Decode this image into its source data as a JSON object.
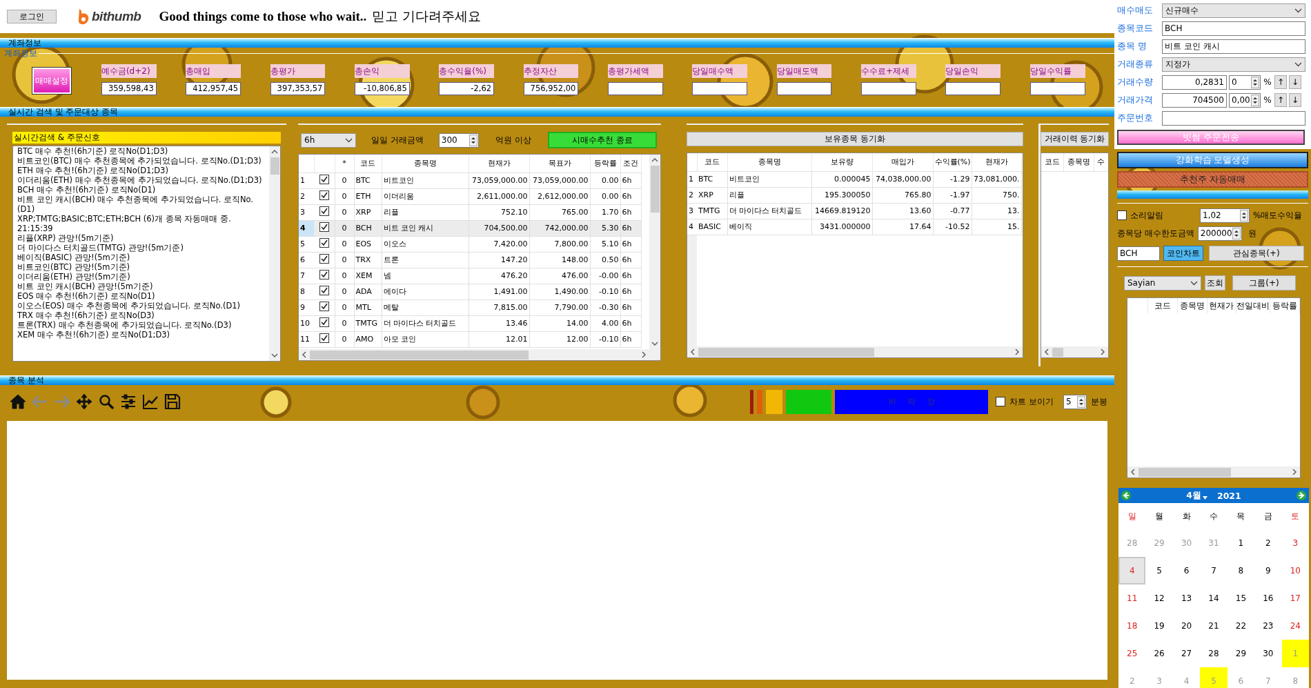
{
  "header": {
    "login_button": "로그인",
    "logo_text": "bithumb",
    "slogan": "Good things come to those who wait..",
    "slogan_korean": "믿고 기다려주세요"
  },
  "account": {
    "bar_title": "계좌정보",
    "group_title": "계좌정보",
    "settings_button": "매매설정",
    "fields": [
      {
        "label": "예수금(d+2)",
        "value": "359,598,43"
      },
      {
        "label": "총매입",
        "value": "412,957,45"
      },
      {
        "label": "총평가",
        "value": "397,353,57"
      },
      {
        "label": "총손익",
        "value": "-10,806,85"
      },
      {
        "label": "총수익율(%)",
        "value": "-2,62"
      },
      {
        "label": "추정자산",
        "value": "756,952,00"
      },
      {
        "label": "총평가세액"
      },
      {
        "label": "당일매수액"
      },
      {
        "label": "당일매도액"
      },
      {
        "label": "수수료+제세"
      },
      {
        "label": "당일손익"
      },
      {
        "label": "당일수익률"
      }
    ]
  },
  "search_bar_title": "실시간 검색 및 주문대상 종목",
  "signal_log": {
    "title": "실시간검색 & 주문신호",
    "lines": [
      "BTC 매수 추천!(6h기준) 로직No(D1;D3)",
      "비트코인(BTC) 매수 추천종목에 추가되었습니다. 로직No.(D1;D3)",
      "ETH 매수 추천!(6h기준) 로직No(D1;D3)",
      "이더리움(ETH) 매수 추천종목에 추가되었습니다. 로직No.(D1;D3)",
      "BCH 매수 추천!(6h기준) 로직No(D1)",
      "비트 코인 캐시(BCH) 매수 추천종목에 추가되었습니다. 로직No.(D1)",
      "XRP;TMTG;BASIC;BTC;ETH;BCH (6)개 종목 자동매매 중. 21:15:39",
      "리플(XRP) 관망!(5m기준)",
      "더 마이다스 터치골드(TMTG) 관망!(5m기준)",
      "베이직(BASIC) 관망!(5m기준)",
      "비트코인(BTC) 관망!(5m기준)",
      "이더리움(ETH) 관망!(5m기준)",
      "비트 코인 캐시(BCH) 관망!(5m기준)",
      "EOS 매수 추천!(6h기준) 로직No(D1)",
      "이오스(EOS) 매수 추천종목에 추가되었습니다. 로직No.(D1)",
      "TRX 매수 추천!(6h기준) 로직No(D3)",
      "트론(TRX) 매수 추천종목에 추가되었습니다. 로직No.(D3)",
      "XEM 매수 추천!(6h기준) 로직No(D1;D3)"
    ]
  },
  "recommend": {
    "interval": "6h",
    "amount_label": "일일 거래금액",
    "amount": "300",
    "unit_label": "억원 이상",
    "stop_button": "시매수추천 종료",
    "columns": [
      "*",
      "코드",
      "종목명",
      "현재가",
      "목표가",
      "등락률",
      "조건"
    ],
    "rows": [
      {
        "num": "1",
        "checked": true,
        "star": "0",
        "code": "BTC",
        "name": "비트코인",
        "price": "73,059,000.00",
        "target": "73,059,000.00",
        "change": "0.00",
        "condition": "6h",
        "selected": false
      },
      {
        "num": "2",
        "checked": true,
        "star": "0",
        "code": "ETH",
        "name": "이더리움",
        "price": "2,611,000.00",
        "target": "2,612,000.00",
        "change": "0.00",
        "condition": "6h",
        "selected": false
      },
      {
        "num": "3",
        "checked": true,
        "star": "0",
        "code": "XRP",
        "name": "리플",
        "price": "752.10",
        "target": "765.00",
        "change": "1.70",
        "condition": "6h",
        "selected": false
      },
      {
        "num": "4",
        "checked": true,
        "star": "0",
        "code": "BCH",
        "name": "비트 코인 캐시",
        "price": "704,500.00",
        "target": "742,000.00",
        "change": "5.30",
        "condition": "6h",
        "selected": true
      },
      {
        "num": "5",
        "checked": true,
        "star": "0",
        "code": "EOS",
        "name": "이오스",
        "price": "7,420.00",
        "target": "7,800.00",
        "change": "5.10",
        "condition": "6h",
        "selected": false
      },
      {
        "num": "6",
        "checked": true,
        "star": "0",
        "code": "TRX",
        "name": "트론",
        "price": "147.20",
        "target": "148.00",
        "change": "0.50",
        "condition": "6h",
        "selected": false
      },
      {
        "num": "7",
        "checked": true,
        "star": "0",
        "code": "XEM",
        "name": "넴",
        "price": "476.20",
        "target": "476.00",
        "change": "-0.00",
        "condition": "6h",
        "selected": false
      },
      {
        "num": "8",
        "checked": true,
        "star": "0",
        "code": "ADA",
        "name": "에이다",
        "price": "1,491.00",
        "target": "1,490.00",
        "change": "-0.10",
        "condition": "6h",
        "selected": false
      },
      {
        "num": "9",
        "checked": true,
        "star": "0",
        "code": "MTL",
        "name": "메탈",
        "price": "7,815.00",
        "target": "7,790.00",
        "change": "-0.30",
        "condition": "6h",
        "selected": false
      },
      {
        "num": "10",
        "checked": true,
        "star": "0",
        "code": "TMTG",
        "name": "더 마이다스 터치골드",
        "price": "13.46",
        "target": "14.00",
        "change": "4.00",
        "condition": "6h",
        "selected": false
      },
      {
        "num": "11",
        "checked": true,
        "star": "0",
        "code": "AMO",
        "name": "아모 코인",
        "price": "12.01",
        "target": "12.00",
        "change": "-0.10",
        "condition": "6h",
        "selected": false
      }
    ]
  },
  "holdings": {
    "sync_button": "보유종목 동기화",
    "columns": [
      "코드",
      "종목명",
      "보유량",
      "매입가",
      "수익률(%)",
      "현재가"
    ],
    "rows": [
      {
        "num": "1",
        "code": "BTC",
        "name": "비트코인",
        "quantity": "0.000045",
        "buy_price": "74,038,000.00",
        "profit_rate": "-1.29",
        "price": "73,081,000."
      },
      {
        "num": "2",
        "code": "XRP",
        "name": "리플",
        "quantity": "195.300050",
        "buy_price": "765.80",
        "profit_rate": "-1.97",
        "price": "750."
      },
      {
        "num": "3",
        "code": "TMTG",
        "name": "더 마이다스 터치골드",
        "quantity": "14669.819120",
        "buy_price": "13.60",
        "profit_rate": "-0.77",
        "price": "13."
      },
      {
        "num": "4",
        "code": "BASIC",
        "name": "베이직",
        "quantity": "3431.000000",
        "buy_price": "17.64",
        "profit_rate": "-10.52",
        "price": "15."
      }
    ]
  },
  "history": {
    "sync_button": "거래이력 동기화",
    "columns": [
      "코드",
      "종목명",
      "수"
    ]
  },
  "analysis": {
    "bar_title": "종목 분석",
    "tools": [
      {
        "kind": "home",
        "disabled": false
      },
      {
        "kind": "back",
        "disabled": true
      },
      {
        "kind": "forward",
        "disabled": true
      },
      {
        "kind": "move",
        "disabled": false
      },
      {
        "kind": "zoom",
        "disabled": false
      },
      {
        "kind": "sliders",
        "disabled": false
      },
      {
        "kind": "line",
        "disabled": false
      },
      {
        "kind": "save",
        "disabled": false
      }
    ],
    "signals": [
      {
        "color": "#a01a10"
      },
      {
        "color": "#e0600a"
      },
      {
        "color": "#f2b705"
      },
      {
        "color": "#10c810"
      },
      {
        "color": "#0000ff",
        "label": "하 락 장"
      }
    ],
    "show_chart": {
      "label": "차트 보이기",
      "checked": false
    },
    "minutes": "5",
    "minutes_unit": "분봉"
  },
  "order": {
    "fields": [
      {
        "kind": "select",
        "label": "매수매도",
        "value": "신규매수"
      },
      {
        "kind": "text",
        "label": "종목코드",
        "value": "BCH"
      },
      {
        "kind": "text",
        "label": "종목 명",
        "value": "비트 코인 캐시"
      },
      {
        "kind": "select",
        "label": "거래종류",
        "value": "지정가"
      },
      {
        "kind": "qty",
        "label": "거래수량",
        "value": "0,2831",
        "spin": "0",
        "unit": "%",
        "up_button": "↑",
        "down_button": "↓"
      },
      {
        "kind": "qty",
        "label": "거래가격",
        "value": "704500",
        "spin": "0,00",
        "unit": "%",
        "up_button": "↑",
        "down_button": "↓"
      },
      {
        "kind": "text",
        "label": "주문번호"
      }
    ],
    "send_button": "빗썸 주문전송",
    "model_button": "강화학습 모델생성",
    "auto_button": "추천주 자동매매",
    "sound_alarm": {
      "label": "소리알림",
      "checked": false
    },
    "sell_rate": "1,02",
    "sell_rate_label": "%매도수익율",
    "limit_label": "종목당 매수한도금액",
    "limit": "200000",
    "limit_unit": "원",
    "chart_code": "BCH",
    "chart_button": "코인차트",
    "watch_button": "관심종목(+)",
    "group_select": "Sayian",
    "query_button": "조회",
    "group_button": "그룹(+)",
    "watch_columns": [
      "코드",
      "종목명",
      "현재가",
      "전일대비",
      "등락률"
    ]
  },
  "calendar": {
    "month": "4월",
    "year": "2021",
    "weekdays": [
      "일",
      "월",
      "화",
      "수",
      "목",
      "금",
      "토"
    ],
    "weeks": [
      [
        {
          "day": "28",
          "other_month": true,
          "selected": false,
          "marked": false
        },
        {
          "day": "29",
          "other_month": true,
          "selected": false,
          "marked": false
        },
        {
          "day": "30",
          "other_month": true,
          "selected": false,
          "marked": false
        },
        {
          "day": "31",
          "other_month": true,
          "selected": false,
          "marked": false
        },
        {
          "day": "1",
          "other_month": false,
          "selected": false,
          "marked": false
        },
        {
          "day": "2",
          "other_month": false,
          "selected": false,
          "marked": false
        },
        {
          "day": "3",
          "other_month": false,
          "selected": false,
          "marked": false
        }
      ],
      [
        {
          "day": "4",
          "other_month": false,
          "selected": true,
          "marked": false
        },
        {
          "day": "5",
          "other_month": false,
          "selected": false,
          "marked": false
        },
        {
          "day": "6",
          "other_month": false,
          "selected": false,
          "marked": false
        },
        {
          "day": "7",
          "other_month": false,
          "selected": false,
          "marked": false
        },
        {
          "day": "8",
          "other_month": false,
          "selected": false,
          "marked": false
        },
        {
          "day": "9",
          "other_month": false,
          "selected": false,
          "marked": false
        },
        {
          "day": "10",
          "other_month": false,
          "selected": false,
          "marked": false
        }
      ],
      [
        {
          "day": "11",
          "other_month": false,
          "selected": false,
          "marked": false
        },
        {
          "day": "12",
          "other_month": false,
          "selected": false,
          "marked": false
        },
        {
          "day": "13",
          "other_month": false,
          "selected": false,
          "marked": false
        },
        {
          "day": "14",
          "other_month": false,
          "selected": false,
          "marked": false
        },
        {
          "day": "15",
          "other_month": false,
          "selected": false,
          "marked": false
        },
        {
          "day": "16",
          "other_month": false,
          "selected": false,
          "marked": false
        },
        {
          "day": "17",
          "other_month": false,
          "selected": false,
          "marked": false
        }
      ],
      [
        {
          "day": "18",
          "other_month": false,
          "selected": false,
          "marked": false
        },
        {
          "day": "19",
          "other_month": false,
          "selected": false,
          "marked": false
        },
        {
          "day": "20",
          "other_month": false,
          "selected": false,
          "marked": false
        },
        {
          "day": "21",
          "other_month": false,
          "selected": false,
          "marked": false
        },
        {
          "day": "22",
          "other_month": false,
          "selected": false,
          "marked": false
        },
        {
          "day": "23",
          "other_month": false,
          "selected": false,
          "marked": false
        },
        {
          "day": "24",
          "other_month": false,
          "selected": false,
          "marked": false
        }
      ],
      [
        {
          "day": "25",
          "other_month": false,
          "selected": false,
          "marked": false
        },
        {
          "day": "26",
          "other_month": false,
          "selected": false,
          "marked": false
        },
        {
          "day": "27",
          "other_month": false,
          "selected": false,
          "marked": false
        },
        {
          "day": "28",
          "other_month": false,
          "selected": false,
          "marked": false
        },
        {
          "day": "29",
          "other_month": false,
          "selected": false,
          "marked": false
        },
        {
          "day": "30",
          "other_month": false,
          "selected": false,
          "marked": false
        },
        {
          "day": "1",
          "other_month": true,
          "selected": false,
          "marked": true
        }
      ],
      [
        {
          "day": "2",
          "other_month": true,
          "selected": false,
          "marked": false
        },
        {
          "day": "3",
          "other_month": true,
          "selected": false,
          "marked": false
        },
        {
          "day": "4",
          "other_month": true,
          "selected": false,
          "marked": false
        },
        {
          "day": "5",
          "other_month": true,
          "selected": false,
          "marked": true
        },
        {
          "day": "6",
          "other_month": true,
          "selected": false,
          "marked": false
        },
        {
          "day": "7",
          "other_month": true,
          "selected": false,
          "marked": false
        },
        {
          "day": "8",
          "other_month": true,
          "selected": false,
          "marked": false
        }
      ]
    ]
  }
}
